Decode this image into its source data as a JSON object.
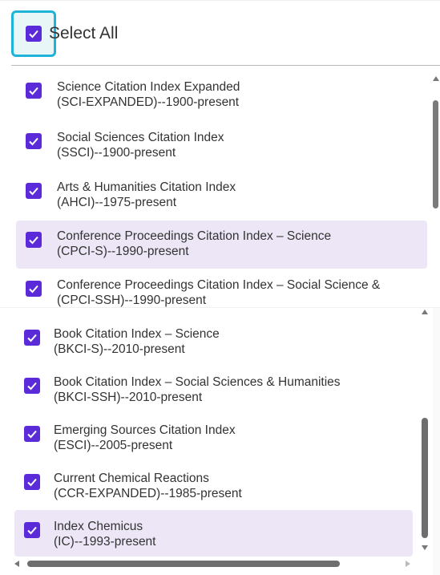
{
  "select_all": {
    "label": "Select All",
    "checked": true
  },
  "top_list": {
    "items": [
      {
        "line1": "Science Citation Index Expanded",
        "line2": "(SCI-EXPANDED)--1900-present",
        "checked": true,
        "highlighted": false
      },
      {
        "line1": "Social Sciences Citation Index",
        "line2": "(SSCI)--1900-present",
        "checked": true,
        "highlighted": false
      },
      {
        "line1": "Arts & Humanities Citation Index",
        "line2": "(AHCI)--1975-present",
        "checked": true,
        "highlighted": false
      },
      {
        "line1": "Conference Proceedings Citation Index – Science",
        "line2": "(CPCI-S)--1990-present",
        "checked": true,
        "highlighted": true
      },
      {
        "line1": "Conference Proceedings Citation Index – Social Science &",
        "line2": "(CPCI-SSH)--1990-present",
        "checked": true,
        "highlighted": false
      }
    ]
  },
  "bottom_list": {
    "items": [
      {
        "line1": "Book Citation Index – Science",
        "line2": "(BKCI-S)--2010-present",
        "checked": true,
        "highlighted": false
      },
      {
        "line1": "Book Citation Index – Social Sciences & Humanities",
        "line2": "(BKCI-SSH)--2010-present",
        "checked": true,
        "highlighted": false
      },
      {
        "line1": "Emerging Sources Citation Index",
        "line2": "(ESCI)--2005-present",
        "checked": true,
        "highlighted": false
      },
      {
        "line1": "Current Chemical Reactions",
        "line2": "(CCR-EXPANDED)--1985-present",
        "checked": true,
        "highlighted": false
      },
      {
        "line1": "Index Chemicus",
        "line2": "(IC)--1993-present",
        "checked": true,
        "highlighted": true
      }
    ]
  },
  "colors": {
    "checkbox": "#5b2bd9",
    "focus_ring": "#1fb3d8",
    "highlight": "#ece6f6"
  }
}
